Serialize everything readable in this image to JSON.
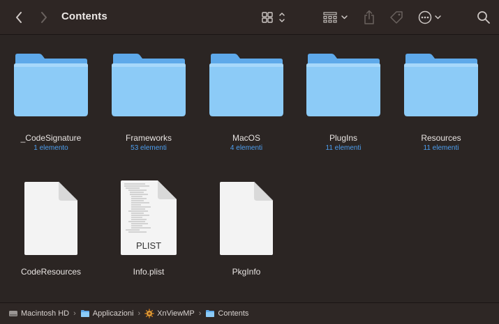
{
  "window": {
    "title": "Contents"
  },
  "toolbar": {
    "back_icon": "chevron-left-icon",
    "forward_icon": "chevron-right-icon",
    "view_icon": "icon-grid-view-icon",
    "group_icon": "group-by-icon",
    "share_icon": "share-icon",
    "tag_icon": "tag-icon",
    "more_icon": "ellipsis-circle-icon",
    "search_icon": "search-icon"
  },
  "items": [
    {
      "name": "_CodeSignature",
      "sub": "1 elemento",
      "kind": "folder"
    },
    {
      "name": "Frameworks",
      "sub": "53 elementi",
      "kind": "folder"
    },
    {
      "name": "MacOS",
      "sub": "4 elementi",
      "kind": "folder"
    },
    {
      "name": "PlugIns",
      "sub": "11 elementi",
      "kind": "folder"
    },
    {
      "name": "Resources",
      "sub": "11 elementi",
      "kind": "folder"
    },
    {
      "name": "CodeResources",
      "sub": "",
      "kind": "file"
    },
    {
      "name": "Info.plist",
      "sub": "",
      "kind": "plist",
      "badge": "PLIST"
    },
    {
      "name": "PkgInfo",
      "sub": "",
      "kind": "file"
    }
  ],
  "pathbar": {
    "crumbs": [
      "Macintosh HD",
      "Applicazioni",
      "XnViewMP",
      "Contents"
    ],
    "separator": "›"
  },
  "colors": {
    "background": "#2b2523",
    "folder_light": "#8ccbf7",
    "folder_dark": "#5ea9ea",
    "sublabel": "#4d9ff0"
  }
}
